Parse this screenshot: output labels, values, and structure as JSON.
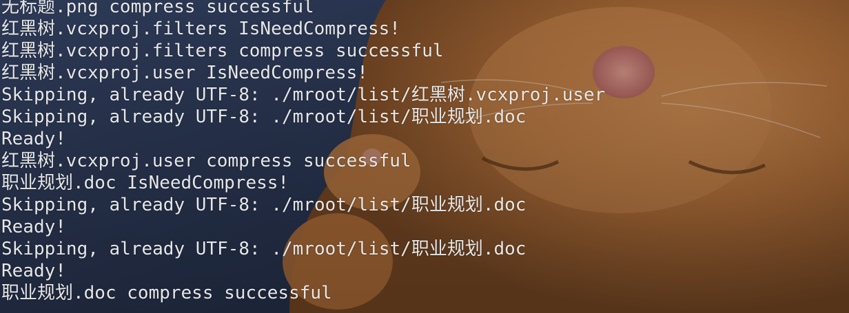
{
  "terminal": {
    "lines": [
      "",
      "无标题.png compress successful",
      "红黑树.vcxproj.filters IsNeedCompress!",
      "红黑树.vcxproj.filters compress successful",
      "红黑树.vcxproj.user IsNeedCompress!",
      "Skipping, already UTF-8: ./mroot/list/红黑树.vcxproj.user",
      "Skipping, already UTF-8: ./mroot/list/职业规划.doc",
      "Ready!",
      "红黑树.vcxproj.user compress successful",
      "职业规划.doc IsNeedCompress!",
      "Skipping, already UTF-8: ./mroot/list/职业规划.doc",
      "Ready!",
      "Skipping, already UTF-8: ./mroot/list/职业规划.doc",
      "Ready!",
      "职业规划.doc compress successful"
    ],
    "colors": {
      "text": "#e6e6e6",
      "background_left": "#2a3650",
      "background_right": "#b9773f"
    },
    "background_image": "kitten-wallpaper"
  }
}
